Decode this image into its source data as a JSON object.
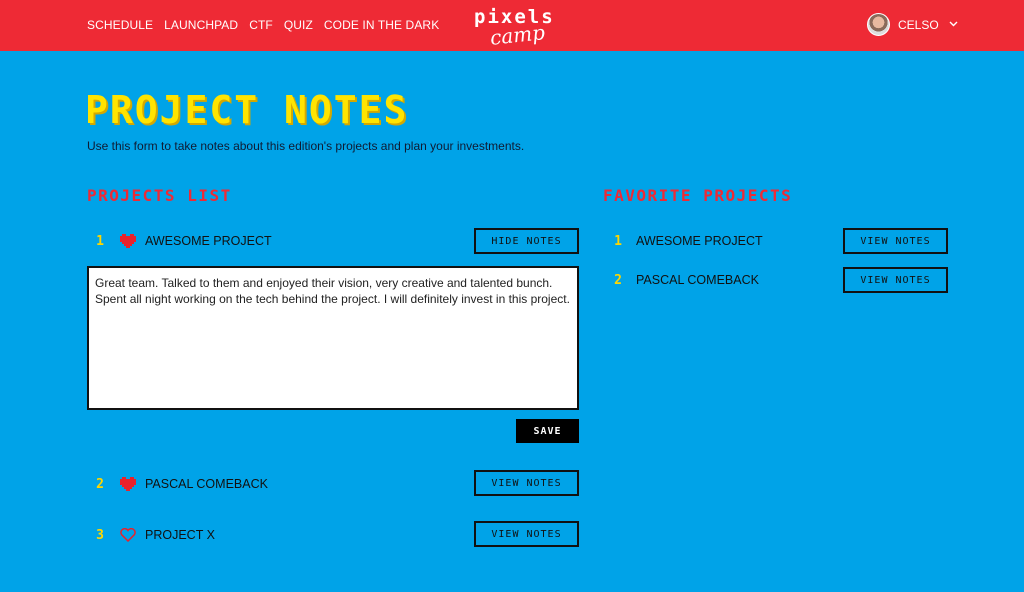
{
  "nav": {
    "items": [
      "SCHEDULE",
      "LAUNCHPAD",
      "CTF",
      "QUIZ",
      "CODE IN THE DARK"
    ]
  },
  "logo": {
    "line1": "PiXELS",
    "line2": "camp"
  },
  "user": {
    "name": "CELSO",
    "dropdown_icon": "chevron-down-icon"
  },
  "page": {
    "title": "PROJECT NOTES",
    "subtitle": "Use this form to take notes about this edition's projects and plan your investments."
  },
  "projects_list": {
    "title": "PROJECTS LIST",
    "items": [
      {
        "number": "1",
        "name": "AWESOME PROJECT",
        "favorite": true,
        "button": "HIDE NOTES"
      },
      {
        "number": "2",
        "name": "PASCAL COMEBACK",
        "favorite": true,
        "button": "VIEW NOTES"
      },
      {
        "number": "3",
        "name": "PROJECT X",
        "favorite": false,
        "button": "VIEW NOTES"
      }
    ],
    "notes_value": "Great team. Talked to them and enjoyed their vision, very creative and talented bunch. Spent all night working on the tech behind the project. I will definitely invest in this project.",
    "save_label": "SAVE"
  },
  "favorites": {
    "title": "FAVORITE PROJECTS",
    "items": [
      {
        "number": "1",
        "name": "AWESOME PROJECT",
        "button": "VIEW NOTES"
      },
      {
        "number": "2",
        "name": "PASCAL COMEBACK",
        "button": "VIEW NOTES"
      }
    ]
  },
  "colors": {
    "background": "#00a3e8",
    "topbar": "#ee2a35",
    "title_yellow": "#ffe400",
    "section_red": "#ee2a35",
    "heart_red": "#e8222c"
  }
}
